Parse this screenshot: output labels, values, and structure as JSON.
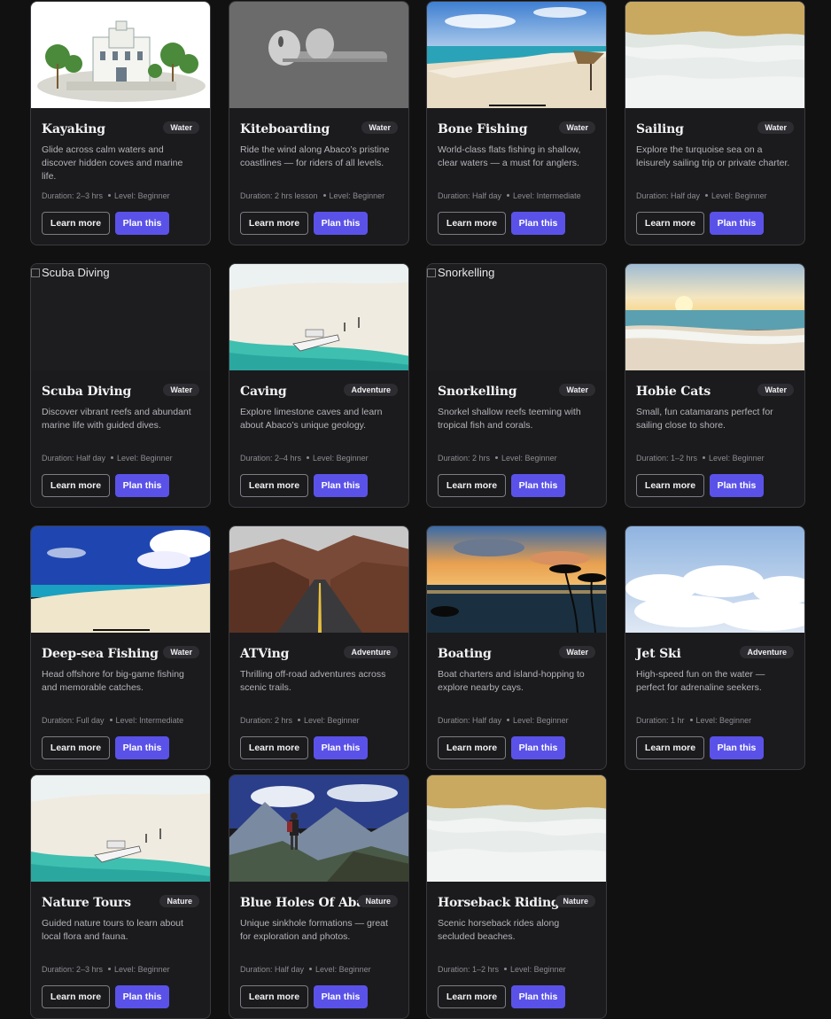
{
  "cards": [
    {
      "title": "Kayaking",
      "badge": "Water",
      "desc": "Glide across calm waters and discover hidden coves and marine life.",
      "duration": "Duration: 2–3 hrs",
      "level": "Level: Beginner",
      "learn": "Learn more",
      "plan": "Plan this",
      "image": "resort-building"
    },
    {
      "title": "Kiteboarding",
      "badge": "Water",
      "desc": "Ride the wind along Abaco’s pristine coastlines — for riders of all levels.",
      "duration": "Duration: 2 hrs lesson",
      "level": "Level: Beginner",
      "learn": "Learn more",
      "plan": "Plan this",
      "image": "earbuds"
    },
    {
      "title": "Bone Fishing",
      "badge": "Water",
      "desc": "World-class flats fishing in shallow, clear waters — a must for anglers.",
      "duration": "Duration: Half day",
      "level": "Level: Intermediate",
      "learn": "Learn more",
      "plan": "Plan this",
      "image": "beach-palapa"
    },
    {
      "title": "Sailing",
      "badge": "Water",
      "desc": "Explore the turquoise sea on a leisurely sailing trip or private charter.",
      "duration": "Duration: Half day",
      "level": "Level: Beginner",
      "learn": "Learn more",
      "plan": "Plan this",
      "image": "sand-waves"
    },
    {
      "title": "Scuba Diving",
      "badge": "Water",
      "desc": "Discover vibrant reefs and abundant marine life with guided dives.",
      "duration": "Duration: Half day",
      "level": "Level: Beginner",
      "learn": "Learn more",
      "plan": "Plan this",
      "image": "broken",
      "alt": "Scuba Diving"
    },
    {
      "title": "Caving",
      "badge": "Adventure",
      "desc": "Explore limestone caves and learn about Abaco’s unique geology.",
      "duration": "Duration: 2–4 hrs",
      "level": "Level: Beginner",
      "learn": "Learn more",
      "plan": "Plan this",
      "image": "boat-sandbar"
    },
    {
      "title": "Snorkelling",
      "badge": "Water",
      "desc": "Snorkel shallow reefs teeming with tropical fish and corals.",
      "duration": "Duration: 2 hrs",
      "level": "Level: Beginner",
      "learn": "Learn more",
      "plan": "Plan this",
      "image": "broken",
      "alt": "Snorkelling"
    },
    {
      "title": "Hobie Cats",
      "badge": "Water",
      "desc": "Small, fun catamarans perfect for sailing close to shore.",
      "duration": "Duration: 1–2 hrs",
      "level": "Level: Beginner",
      "learn": "Learn more",
      "plan": "Plan this",
      "image": "sunset-beach"
    },
    {
      "title": "Deep-sea Fishing",
      "badge": "Water",
      "desc": "Head offshore for big-game fishing and memorable catches.",
      "duration": "Duration: Full day",
      "level": "Level: Intermediate",
      "learn": "Learn more",
      "plan": "Plan this",
      "image": "blue-sky-beach"
    },
    {
      "title": "ATVing",
      "badge": "Adventure",
      "desc": "Thrilling off-road adventures across scenic trails.",
      "duration": "Duration: 2 hrs",
      "level": "Level: Beginner",
      "learn": "Learn more",
      "plan": "Plan this",
      "image": "canyon-road"
    },
    {
      "title": "Boating",
      "badge": "Water",
      "desc": "Boat charters and island-hopping to explore nearby cays.",
      "duration": "Duration: Half day",
      "level": "Level: Beginner",
      "learn": "Learn more",
      "plan": "Plan this",
      "image": "palm-sunset"
    },
    {
      "title": "Jet Ski",
      "badge": "Adventure",
      "desc": "High-speed fun on the water — perfect for adrenaline seekers.",
      "duration": "Duration: 1 hr",
      "level": "Level: Beginner",
      "learn": "Learn more",
      "plan": "Plan this",
      "image": "clouds"
    },
    {
      "title": "Nature Tours",
      "badge": "Nature",
      "desc": "Guided nature tours to learn about local flora and fauna.",
      "duration": "Duration: 2–3 hrs",
      "level": "Level: Beginner",
      "learn": "Learn more",
      "plan": "Plan this",
      "image": "boat-sandbar"
    },
    {
      "title": "Blue Holes Of Abaco",
      "badge": "Nature",
      "desc": "Unique sinkhole formations — great for exploration and photos.",
      "duration": "Duration: Half day",
      "level": "Level: Beginner",
      "learn": "Learn more",
      "plan": "Plan this",
      "image": "mountain-hiker"
    },
    {
      "title": "Horseback Riding",
      "badge": "Nature",
      "desc": "Scenic horseback rides along secluded beaches.",
      "duration": "Duration: 1–2 hrs",
      "level": "Level: Beginner",
      "learn": "Learn more",
      "plan": "Plan this",
      "image": "sand-waves"
    }
  ]
}
